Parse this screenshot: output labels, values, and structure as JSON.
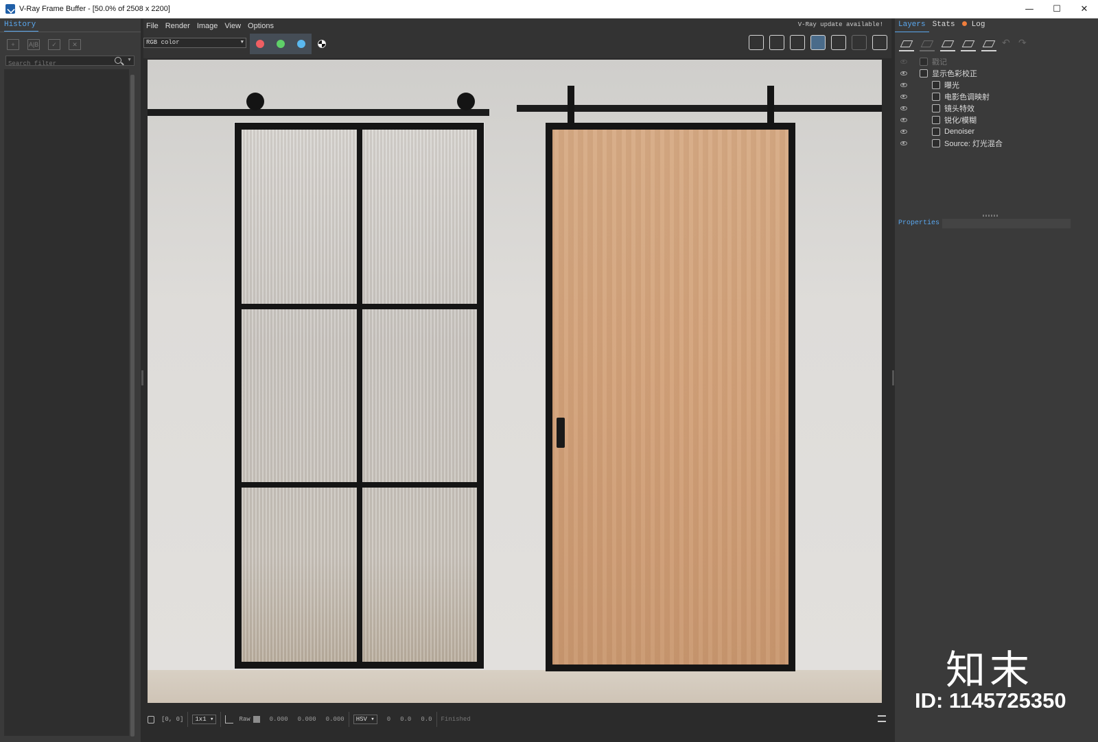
{
  "window": {
    "title": "V-Ray Frame Buffer - [50.0% of 2508 x 2200]",
    "controls": {
      "minimize": "—",
      "maximize": "☐",
      "close": "✕"
    }
  },
  "history": {
    "tab_label": "History",
    "search_placeholder": "Search filter",
    "tools": [
      "save-history-icon",
      "ab-compare-icon",
      "load-history-icon",
      "remove-history-icon"
    ]
  },
  "menu": {
    "items": [
      "File",
      "Render",
      "Image",
      "View",
      "Options"
    ],
    "update_notice": "V-Ray update available!"
  },
  "toolbar": {
    "channel": "RGB color",
    "channel_buttons": [
      {
        "name": "red-channel-button",
        "color": "#ef5f63"
      },
      {
        "name": "green-channel-button",
        "color": "#5fd069"
      },
      {
        "name": "blue-channel-button",
        "color": "#5ab8ef"
      }
    ],
    "right_tools": [
      "save-image-icon",
      "clear-image-icon",
      "region-render-icon",
      "track-mouse-icon",
      "render-icon",
      "interactive-render-icon",
      "teapot-icon"
    ]
  },
  "status": {
    "coords": "[0, 0]",
    "zoom": "1x1",
    "raw": "Raw",
    "r": "0.000",
    "g": "0.000",
    "b": "0.000",
    "color_mode": "HSV",
    "h": "0",
    "s": "0.0",
    "v": "0.0",
    "state": "Finished"
  },
  "layers_panel": {
    "tabs": [
      "Layers",
      "Stats",
      "Log"
    ],
    "layers": [
      {
        "label": "戳记",
        "level": 1,
        "visible": false,
        "dim": true
      },
      {
        "label": "显示色彩校正",
        "level": 1,
        "visible": true,
        "dim": false
      },
      {
        "label": "曝光",
        "level": 2,
        "visible": true,
        "dim": false
      },
      {
        "label": "电影色调映射",
        "level": 2,
        "visible": true,
        "dim": false
      },
      {
        "label": "镜头特效",
        "level": 2,
        "visible": true,
        "dim": false
      },
      {
        "label": "锐化/模糊",
        "level": 2,
        "visible": true,
        "dim": false
      },
      {
        "label": "Denoiser",
        "level": 2,
        "visible": true,
        "dim": false
      },
      {
        "label": "Source: 灯光混合",
        "level": 2,
        "visible": true,
        "dim": false
      }
    ],
    "properties_label": "Properties"
  },
  "watermark": {
    "logo": "知末",
    "id": "ID: 1145725350"
  }
}
